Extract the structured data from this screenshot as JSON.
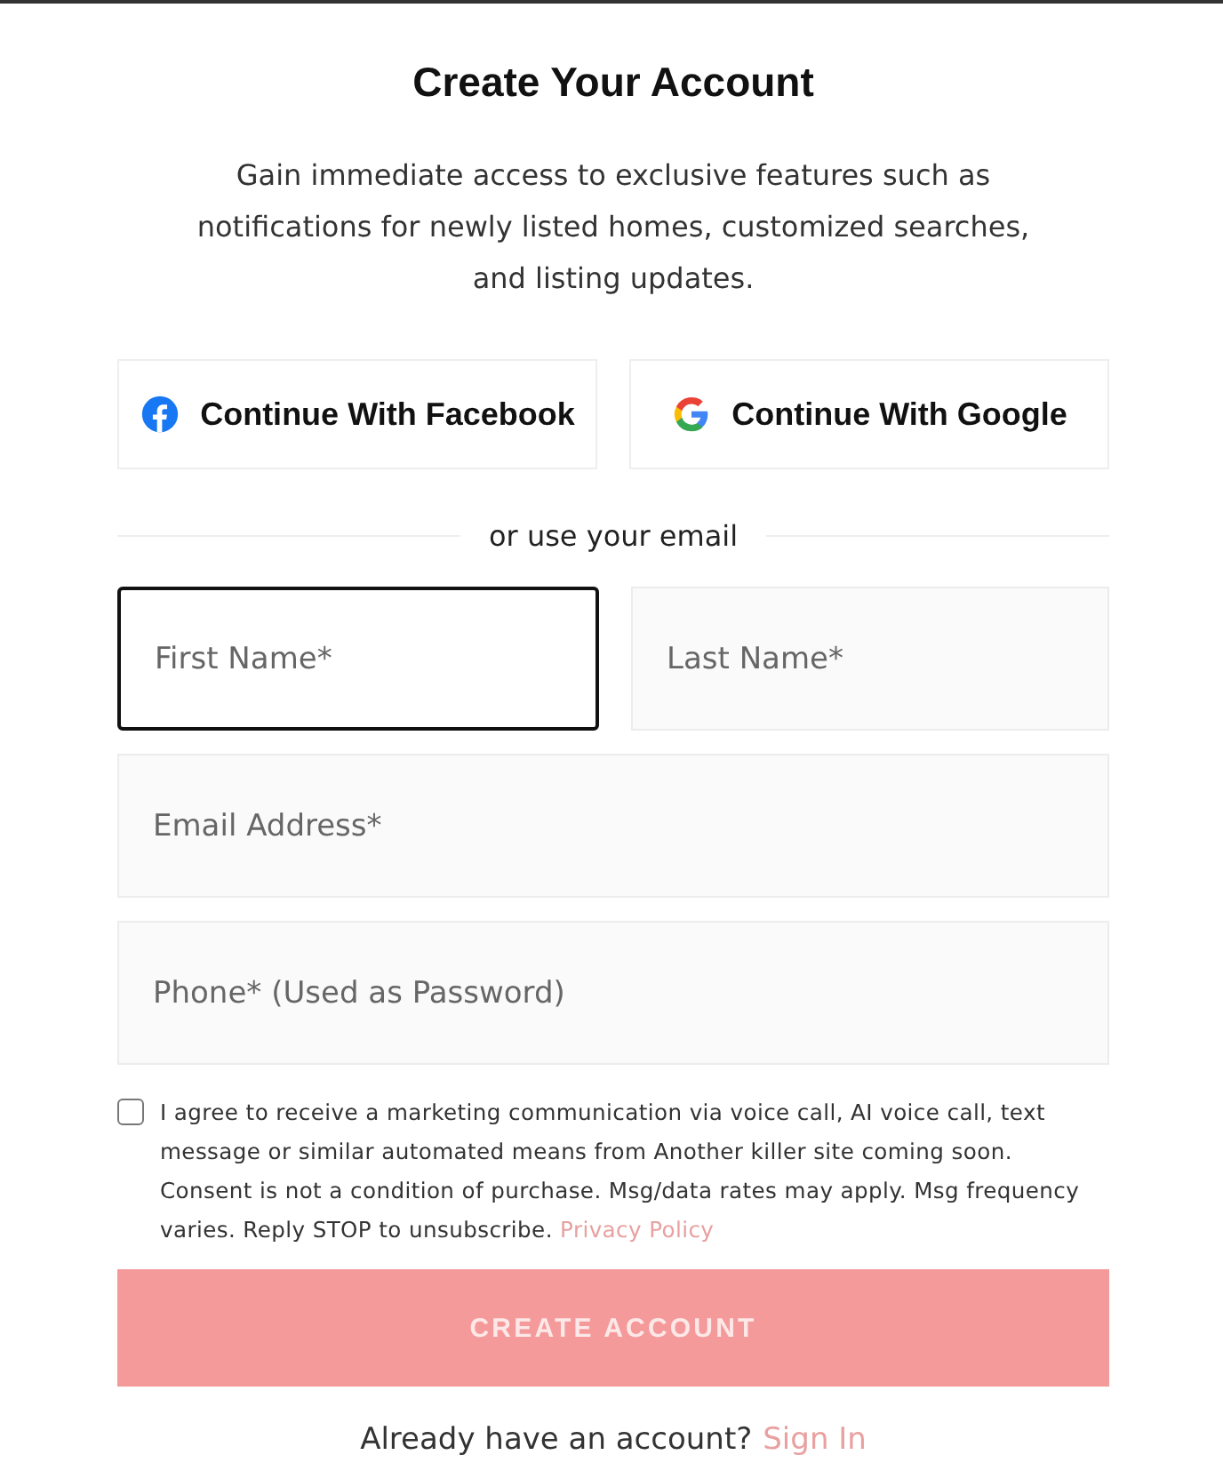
{
  "title": "Create Your Account",
  "intro": "Gain immediate access to exclusive features such as notifications for newly listed homes, customized searches, and listing updates.",
  "social_buttons": [
    {
      "kind": "facebook",
      "label": "Continue With Facebook"
    },
    {
      "kind": "google",
      "label": "Continue With Google"
    }
  ],
  "divider_text": "or use your email",
  "field_rows": [
    [
      {
        "placeholder": "First Name*",
        "focused": true
      },
      {
        "placeholder": "Last Name*",
        "focused": false
      }
    ],
    [
      {
        "placeholder": "Email Address*",
        "focused": false
      }
    ],
    [
      {
        "placeholder": "Phone* (Used as Password)",
        "focused": false
      }
    ]
  ],
  "consent": {
    "checked": false,
    "text": "I agree to receive a marketing communication via voice call, AI voice call, text message or similar automated means from Another killer site coming soon. Consent is not a condition of purchase. Msg/data rates may apply. Msg frequency varies. Reply STOP to unsubscribe.",
    "link": "Privacy Policy"
  },
  "submit": "CREATE ACCOUNT",
  "signin": {
    "text": "Already have an account?",
    "link": "Sign In"
  }
}
